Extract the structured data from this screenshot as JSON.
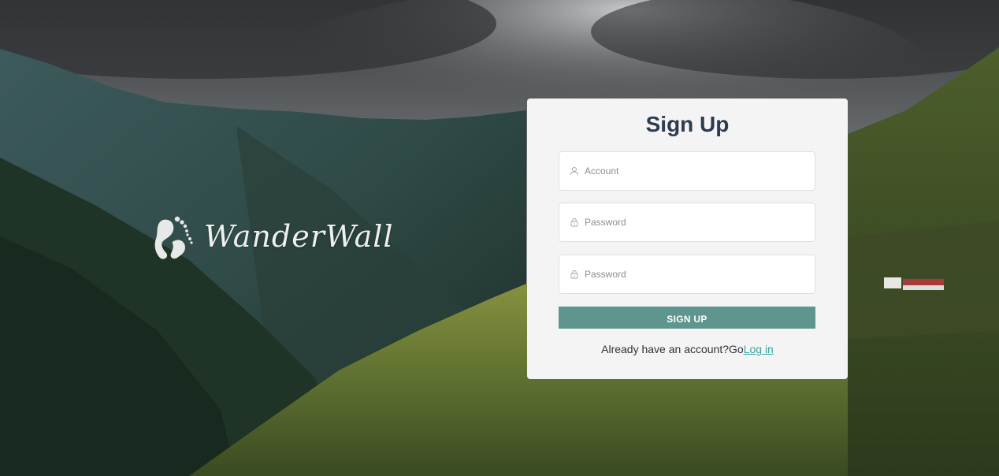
{
  "brand": {
    "name": "WanderWall"
  },
  "form": {
    "title": "Sign Up",
    "account_placeholder": "Account",
    "password_placeholder": "Password",
    "confirm_placeholder": "Password",
    "submit_label": "SIGN UP",
    "login_prompt": "Already have an account?Go",
    "login_link": "Log in"
  },
  "colors": {
    "accent": "#5e958d",
    "link": "#3aa5a0",
    "title": "#2d3b4e",
    "card": "#f4f4f4"
  },
  "icons": [
    "user-icon",
    "lock-icon",
    "footprint-icon"
  ]
}
